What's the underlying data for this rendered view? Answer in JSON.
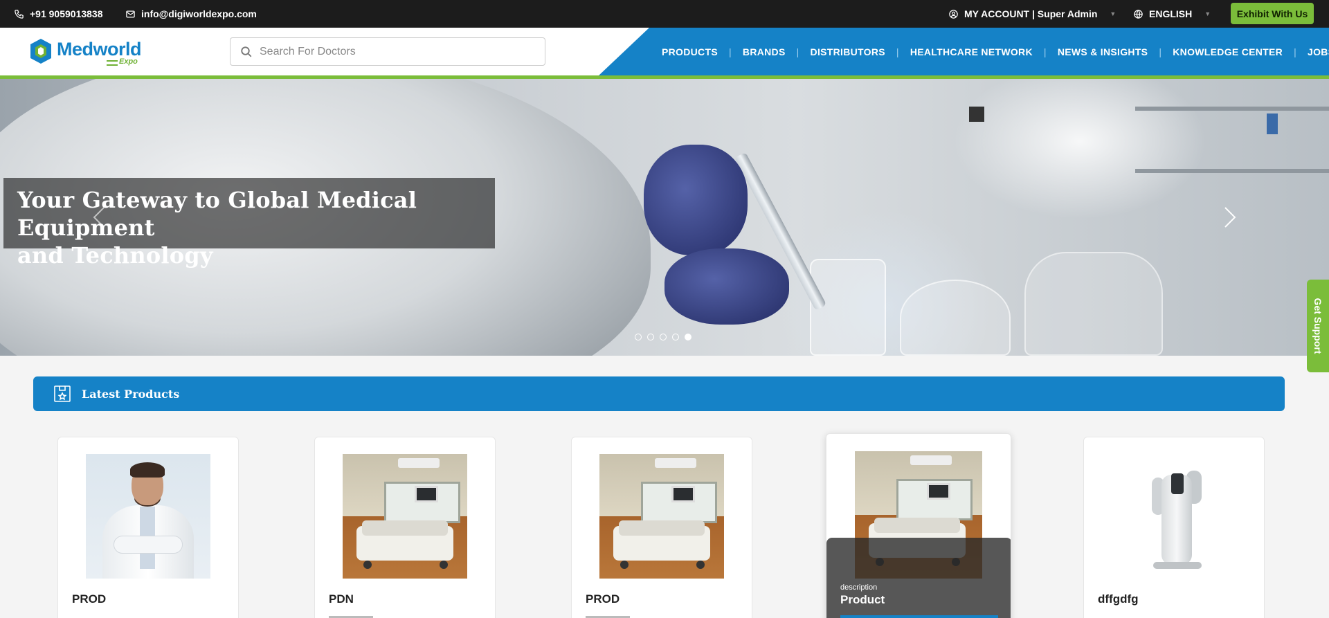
{
  "topbar": {
    "phone": "+91 9059013838",
    "email": "info@digiworldexpo.com",
    "account": "MY ACCOUNT | Super Admin",
    "language": "ENGLISH",
    "exhibit_label": "Exhibit With Us",
    "icons": [
      "phone-icon",
      "mail-icon",
      "user-circle-icon",
      "globe-icon",
      "chevron-down-icon"
    ]
  },
  "header": {
    "logo_main": "Medworld",
    "logo_sub": "Expo",
    "search_placeholder": "Search For Doctors",
    "nav": [
      "PRODUCTS",
      "BRANDS",
      "DISTRIBUTORS",
      "HEALTHCARE NETWORK",
      "NEWS & INSIGHTS",
      "KNOWLEDGE CENTER",
      "JOBS"
    ],
    "nav_separator": "|"
  },
  "hero": {
    "caption_line1": "Your Gateway to Global Medical Equipment",
    "caption_line2": "and Technology",
    "slide_count": 5,
    "active_slide": 5
  },
  "support_tab": {
    "label": "Get Support"
  },
  "section": {
    "title": "Latest Products",
    "icon": "product-box-icon"
  },
  "products": [
    {
      "name": "PROD",
      "image": "doctor-photo"
    },
    {
      "name": "PDN",
      "image": "hospital-bed-photo"
    },
    {
      "name": "PROD",
      "image": "hospital-bed-photo"
    },
    {
      "name": "Product",
      "image": "hospital-bed-photo",
      "hover_label": "description"
    },
    {
      "name": "dffgdfg",
      "image": "aesthetic-device-photo"
    }
  ],
  "colors": {
    "brand_blue": "#1582c7",
    "brand_green": "#7bbd3a",
    "topbar_bg": "#1c1c1c",
    "page_bg": "#f4f4f4"
  }
}
